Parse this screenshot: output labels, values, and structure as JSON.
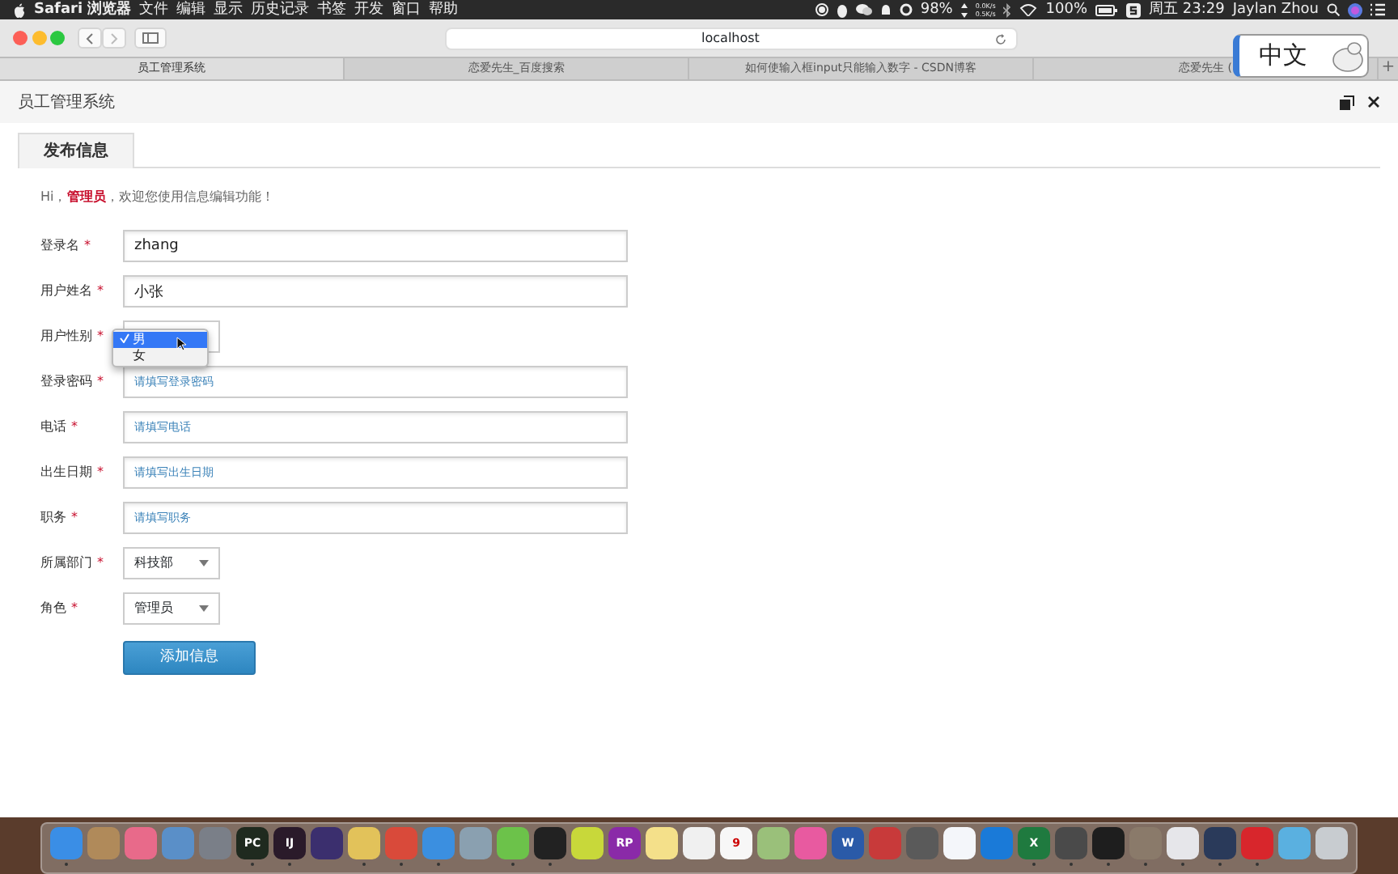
{
  "menu_bar": {
    "app_name": "Safari 浏览器",
    "menus": [
      "文件",
      "编辑",
      "显示",
      "历史记录",
      "书签",
      "开发",
      "窗口",
      "帮助"
    ],
    "battery_percent": "98%",
    "net_up": "0.0K/s",
    "net_down": "0.5K/s",
    "wifi_battery": "100%",
    "clock": "周五 23:29",
    "user": "Jaylan Zhou"
  },
  "toolbar": {
    "address": "localhost"
  },
  "tabs": [
    {
      "label": "员工管理系统",
      "selected": true
    },
    {
      "label": "恋爱先生_百度搜索",
      "selected": false
    },
    {
      "label": "如何使输入框input只能输入数字 - CSDN博客",
      "selected": false
    },
    {
      "label": "恋爱先生 (",
      "selected": false
    }
  ],
  "new_tab": "+",
  "ime_popup": {
    "text": "中文"
  },
  "page": {
    "title": "员工管理系统",
    "section_tab": "发布信息",
    "welcome": "Hi，**管理员**，欢迎您使用信息编辑功能！",
    "fields": [
      {
        "label": "登录名",
        "required_mark": "*",
        "kind": "text",
        "value": "zhang"
      },
      {
        "label": "用户姓名",
        "required_mark": "*",
        "kind": "text",
        "value": "小张"
      },
      {
        "label": "用户性别",
        "required_mark": "*",
        "kind": "select",
        "expanded": true,
        "options": [
          {
            "label": "男",
            "selected": true
          },
          {
            "label": "女",
            "selected": false
          }
        ]
      },
      {
        "label": "登录密码",
        "required_mark": "*",
        "kind": "text",
        "placeholder": "请填写登录密码"
      },
      {
        "label": "电话",
        "required_mark": "*",
        "kind": "text",
        "placeholder": "请填写电话"
      },
      {
        "label": "出生日期",
        "required_mark": "*",
        "kind": "text",
        "placeholder": "请填写出生日期"
      },
      {
        "label": "职务",
        "required_mark": "*",
        "kind": "text",
        "placeholder": "请填写职务"
      },
      {
        "label": "所属部门",
        "required_mark": "*",
        "kind": "select",
        "value": "科技部"
      },
      {
        "label": "角色",
        "required_mark": "*",
        "kind": "select",
        "value": "管理员"
      }
    ],
    "submit": "添加信息"
  },
  "dock": [
    {
      "color": "#3a8ee6",
      "running": true
    },
    {
      "color": "#b08a5a",
      "running": false
    },
    {
      "color": "#e86a8a",
      "running": false
    },
    {
      "color": "#5a8fc8",
      "running": false
    },
    {
      "color": "#7a7f88",
      "running": false
    },
    {
      "color": "#1f2a1f",
      "label": "PC",
      "running": true
    },
    {
      "color": "#2a1a2a",
      "label": "IJ",
      "running": true
    },
    {
      "color": "#3b2f6e",
      "running": false
    },
    {
      "color": "#e2c25a",
      "running": true
    },
    {
      "color": "#d94a3a",
      "running": true
    },
    {
      "color": "#3b8fe0",
      "running": true
    },
    {
      "color": "#8aa0b0",
      "running": false
    },
    {
      "color": "#6cc24a",
      "running": true
    },
    {
      "color": "#222222",
      "running": true
    },
    {
      "color": "#c8d83a",
      "running": false
    },
    {
      "color": "#8a2aa8",
      "label": "RP",
      "running": false
    },
    {
      "color": "#f4e08a",
      "running": false
    },
    {
      "color": "#f0f0f0",
      "running": false
    },
    {
      "color": "#f7f7f7",
      "label": "9",
      "running": false
    },
    {
      "color": "#9ac07a",
      "running": false
    },
    {
      "color": "#e85aa0",
      "running": false
    },
    {
      "color": "#2a5aa8",
      "label": "W",
      "running": false
    },
    {
      "color": "#c83a3a",
      "running": false
    },
    {
      "color": "#5a5a5a",
      "running": false
    },
    {
      "color": "#f4f6fa",
      "running": false
    },
    {
      "color": "#1a7ad8",
      "running": false
    },
    {
      "color": "#1f7a3f",
      "label": "X",
      "running": true
    },
    {
      "color": "#4a4a4a",
      "running": true
    },
    {
      "color": "#1e1e1e",
      "running": true
    },
    {
      "color": "#8a7a6a",
      "running": true
    },
    {
      "color": "#e6e6ea",
      "running": true
    },
    {
      "color": "#2a3a5a",
      "running": true
    },
    {
      "color": "#d8262c",
      "running": true
    },
    {
      "color": "#5ab0e0",
      "running": false
    },
    {
      "color": "#c8ccd0",
      "running": false
    }
  ]
}
